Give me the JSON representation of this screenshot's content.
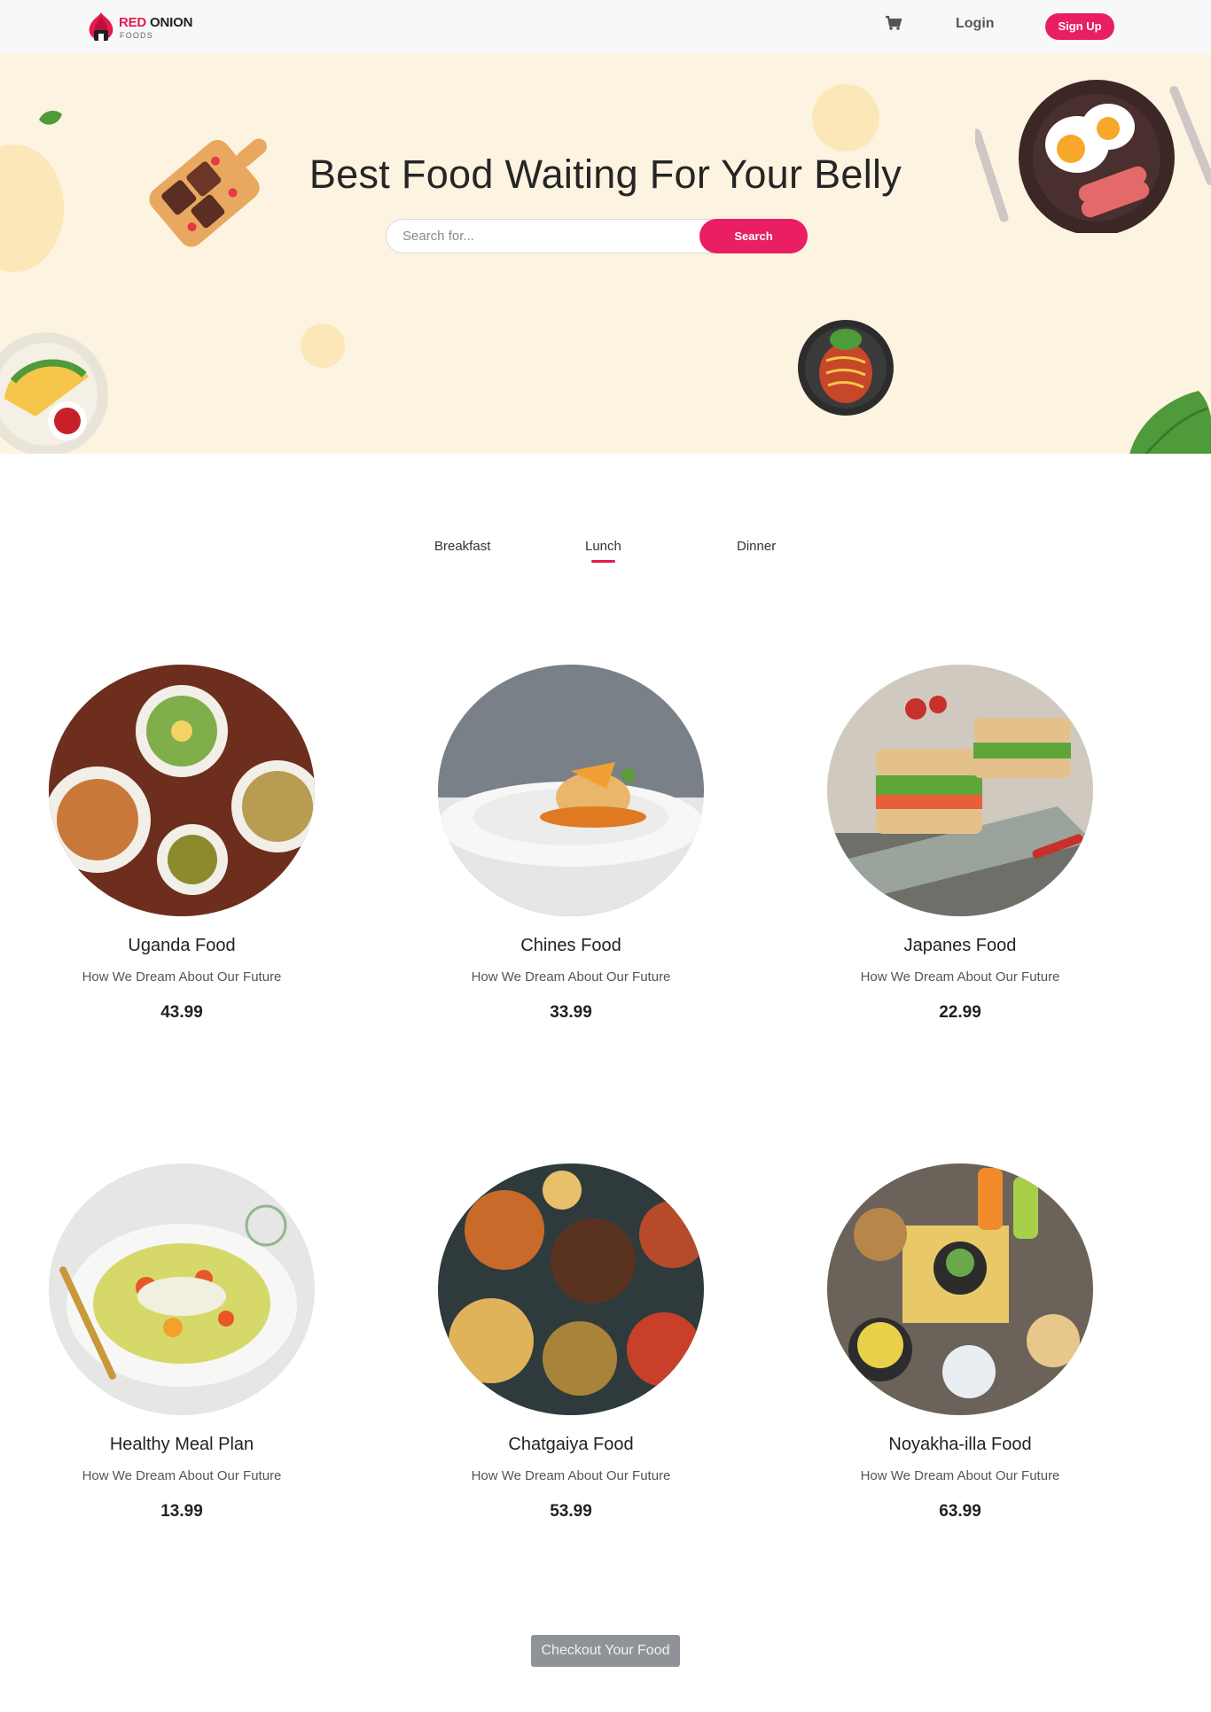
{
  "brand": {
    "name_part1": "RED",
    "name_part2": "ONION",
    "sub": "FOODS",
    "accent": "#e51a4c"
  },
  "nav": {
    "login_label": "Login",
    "signup_label": "Sign Up",
    "cart_icon": "cart-icon"
  },
  "hero": {
    "title": "Best Food Waiting For Your Belly",
    "search_placeholder": "Search for...",
    "search_button": "Search",
    "background": "#fdf3e1"
  },
  "tabs": [
    {
      "label": "Breakfast",
      "active": false
    },
    {
      "label": "Lunch",
      "active": true
    },
    {
      "label": "Dinner",
      "active": false
    }
  ],
  "foods": [
    {
      "name": "Uganda Food",
      "desc": "How We Dream About Our Future",
      "price": "43.99"
    },
    {
      "name": "Chines Food",
      "desc": "How We Dream About Our Future",
      "price": "33.99"
    },
    {
      "name": "Japanes Food",
      "desc": "How We Dream About Our Future",
      "price": "22.99"
    },
    {
      "name": "Healthy Meal Plan",
      "desc": "How We Dream About Our Future",
      "price": "13.99"
    },
    {
      "name": "Chatgaiya Food",
      "desc": "How We Dream About Our Future",
      "price": "53.99"
    },
    {
      "name": "Noyakha-illa Food",
      "desc": "How We Dream About Our Future",
      "price": "63.99"
    }
  ],
  "checkout_label": "Checkout Your Food"
}
